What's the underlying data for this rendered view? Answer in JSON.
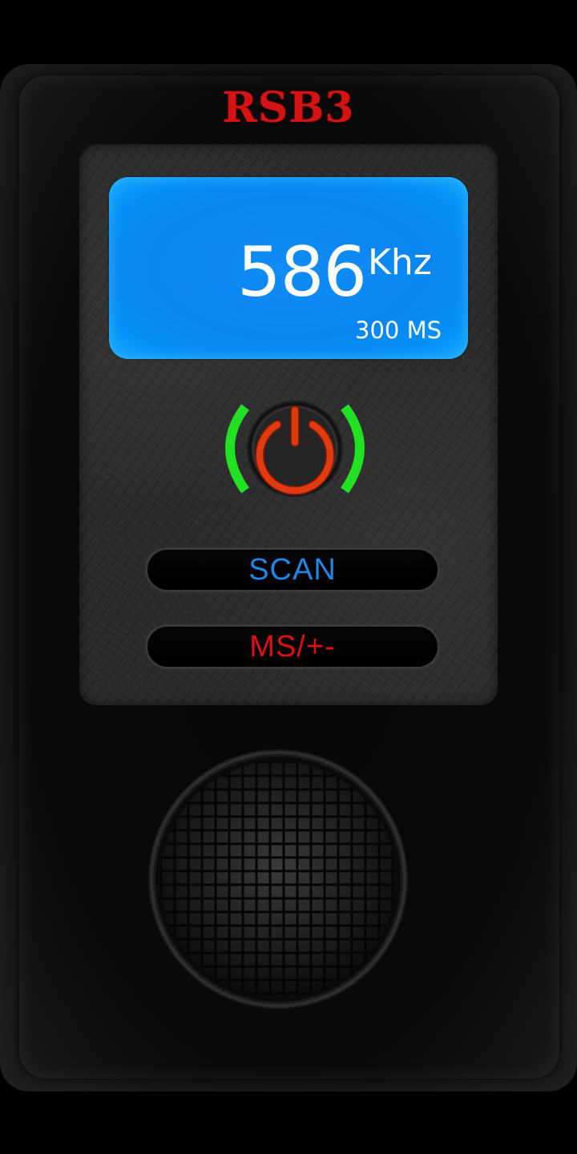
{
  "brand": {
    "title": "RSB3",
    "color": "#d41414"
  },
  "display": {
    "frequency": "586",
    "unit": "Khz",
    "interval": "300 MS",
    "background": "#0a86f2"
  },
  "power_button": {
    "icon": "power-icon",
    "ring_color": "#e03a10",
    "bracket_color": "#22e022",
    "state": "on"
  },
  "buttons": {
    "scan_label": "SCAN",
    "scan_color": "#1f86e6",
    "ms_label": "MS/+-",
    "ms_color": "#e01010"
  },
  "speaker": {
    "icon": "speaker-grille-icon"
  }
}
